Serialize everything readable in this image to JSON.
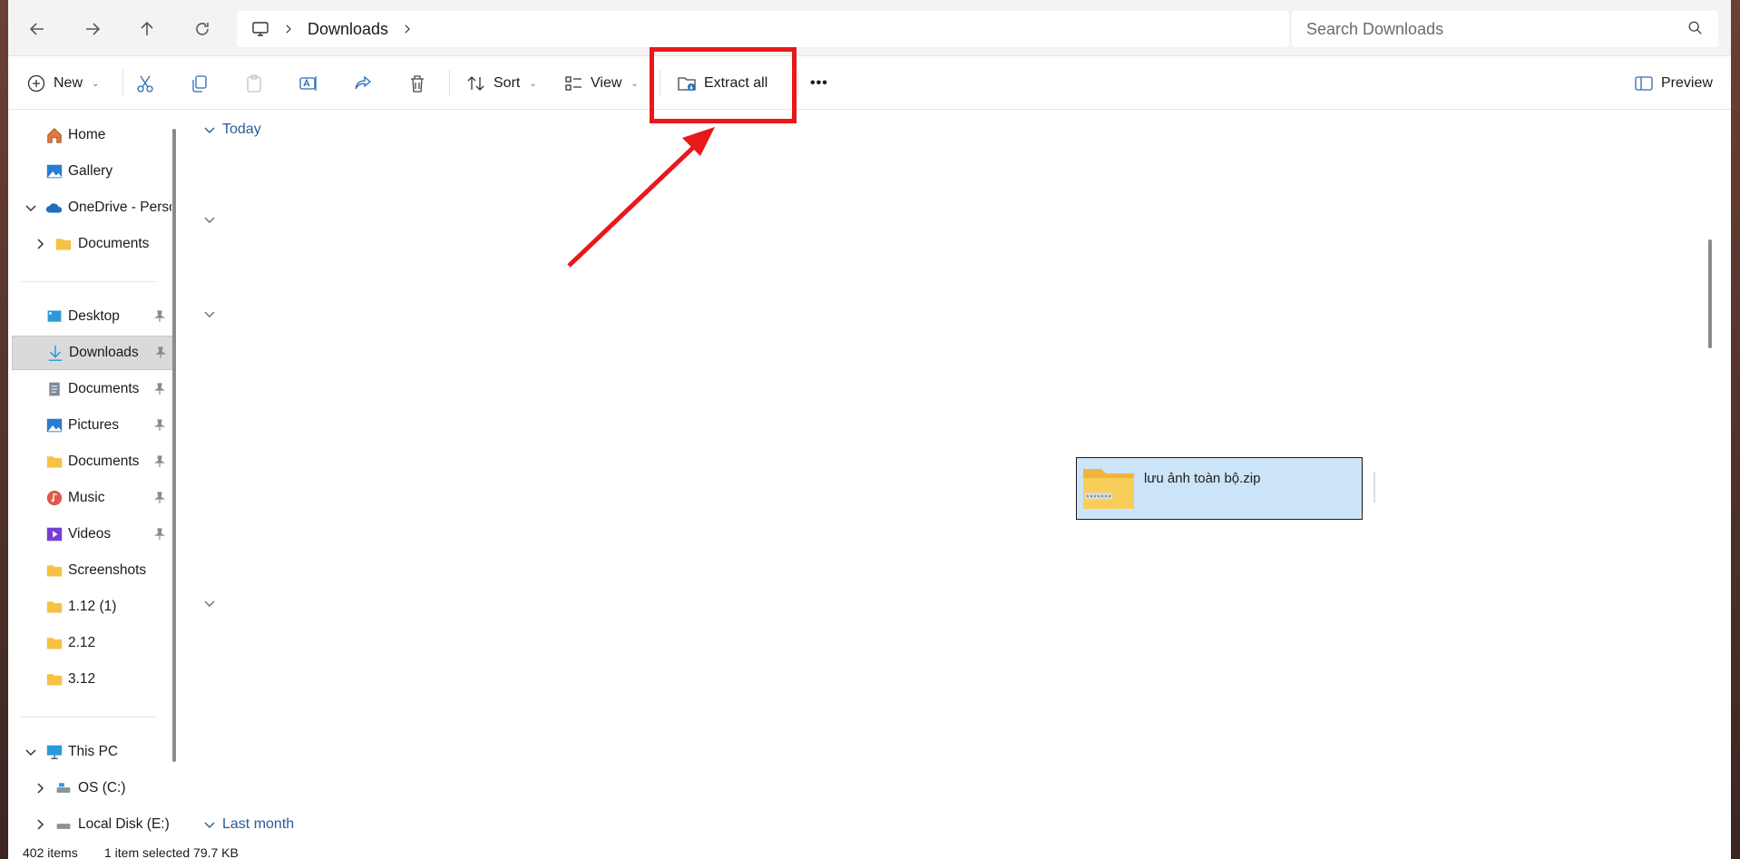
{
  "address": {
    "location_icon": "this-pc-icon",
    "current_folder": "Downloads"
  },
  "search": {
    "placeholder": "Search Downloads"
  },
  "toolbar": {
    "new_label": "New",
    "sort_label": "Sort",
    "view_label": "View",
    "extract_label": "Extract all",
    "more_label": "•••",
    "preview_label": "Preview"
  },
  "sidebar": {
    "items": [
      {
        "label": "Home",
        "icon": "home-icon"
      },
      {
        "label": "Gallery",
        "icon": "gallery-icon"
      },
      {
        "label": "OneDrive - Perso",
        "icon": "onedrive-icon"
      },
      {
        "label": "Documents",
        "icon": "folder-icon"
      },
      {
        "label": "Desktop",
        "icon": "desktop-icon"
      },
      {
        "label": "Downloads",
        "icon": "download-icon"
      },
      {
        "label": "Documents",
        "icon": "document-icon"
      },
      {
        "label": "Pictures",
        "icon": "pictures-icon"
      },
      {
        "label": "Documents",
        "icon": "folder-icon"
      },
      {
        "label": "Music",
        "icon": "music-icon"
      },
      {
        "label": "Videos",
        "icon": "videos-icon"
      },
      {
        "label": "Screenshots",
        "icon": "folder-icon"
      },
      {
        "label": "1.12 (1)",
        "icon": "folder-icon"
      },
      {
        "label": "2.12",
        "icon": "folder-icon"
      },
      {
        "label": "3.12",
        "icon": "folder-icon"
      },
      {
        "label": "This PC",
        "icon": "this-pc-icon"
      },
      {
        "label": "OS (C:)",
        "icon": "drive-icon"
      },
      {
        "label": "Local Disk (E:)",
        "icon": "drive-icon"
      }
    ]
  },
  "content": {
    "group_today": "Today",
    "group_last_month": "Last month",
    "selected_file": "lưu ảnh toàn bộ.zip"
  },
  "status": {
    "item_count": "402 items",
    "selection": "1 item selected  79.7 KB"
  },
  "colors": {
    "highlight_red": "#e8181b",
    "selection_blue": "#cce4f7",
    "group_header": "#2a5c9a"
  }
}
